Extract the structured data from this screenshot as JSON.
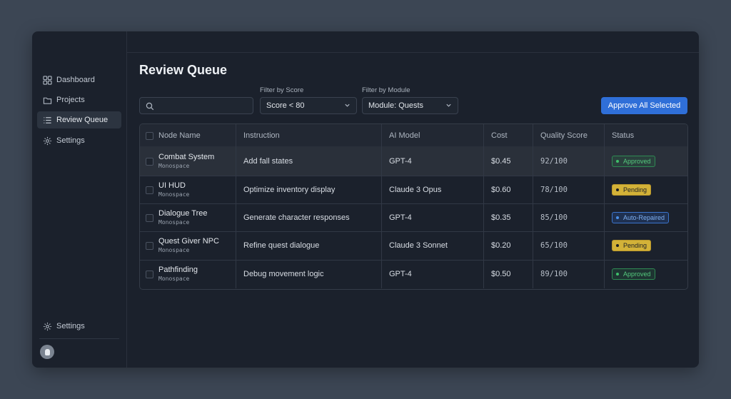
{
  "page_title": "Review Queue",
  "sidebar": {
    "items": [
      {
        "label": "Dashboard",
        "icon": "grid-icon"
      },
      {
        "label": "Projects",
        "icon": "folder-icon"
      },
      {
        "label": "Review Queue",
        "icon": "list-icon",
        "active": true
      },
      {
        "label": "Settings",
        "icon": "gear-icon"
      }
    ],
    "bottom_settings_label": "Settings"
  },
  "search": {
    "value": "",
    "placeholder": ""
  },
  "filters": {
    "score_label": "Filter by Score",
    "score_value": "Score < 80",
    "module_label": "Filter by Module",
    "module_value": "Module: Quests"
  },
  "approve_all_label": "Approve All Selected",
  "table": {
    "headers": [
      "Node Name",
      "Instruction",
      "AI Model",
      "Cost",
      "Quality Score",
      "Status"
    ],
    "rows": [
      {
        "node": "Combat System",
        "sub": "Monospace",
        "instruction": "Add fall states",
        "model": "GPT-4",
        "cost": "$0.45",
        "score": "92/100",
        "status": "Approved",
        "status_kind": "approved"
      },
      {
        "node": "UI HUD",
        "sub": "Monospace",
        "instruction": "Optimize inventory display",
        "model": "Claude 3 Opus",
        "cost": "$0.60",
        "score": "78/100",
        "status": "Pending",
        "status_kind": "pending"
      },
      {
        "node": "Dialogue Tree",
        "sub": "Monospace",
        "instruction": "Generate character responses",
        "model": "GPT-4",
        "cost": "$0.35",
        "score": "85/100",
        "status": "Auto-Repaired",
        "status_kind": "repaired"
      },
      {
        "node": "Quest Giver NPC",
        "sub": "Monospace",
        "instruction": "Refine quest dialogue",
        "model": "Claude 3 Sonnet",
        "cost": "$0.20",
        "score": "65/100",
        "status": "Pending",
        "status_kind": "pending"
      },
      {
        "node": "Pathfinding",
        "sub": "Monospace",
        "instruction": "Debug movement logic",
        "model": "GPT-4",
        "cost": "$0.50",
        "score": "89/100",
        "status": "Approved",
        "status_kind": "approved"
      }
    ]
  },
  "colors": {
    "accent": "#2f6fd8",
    "approved": "#3fbf6a",
    "pending": "#e3bf3a",
    "repaired": "#4a8fe8"
  }
}
